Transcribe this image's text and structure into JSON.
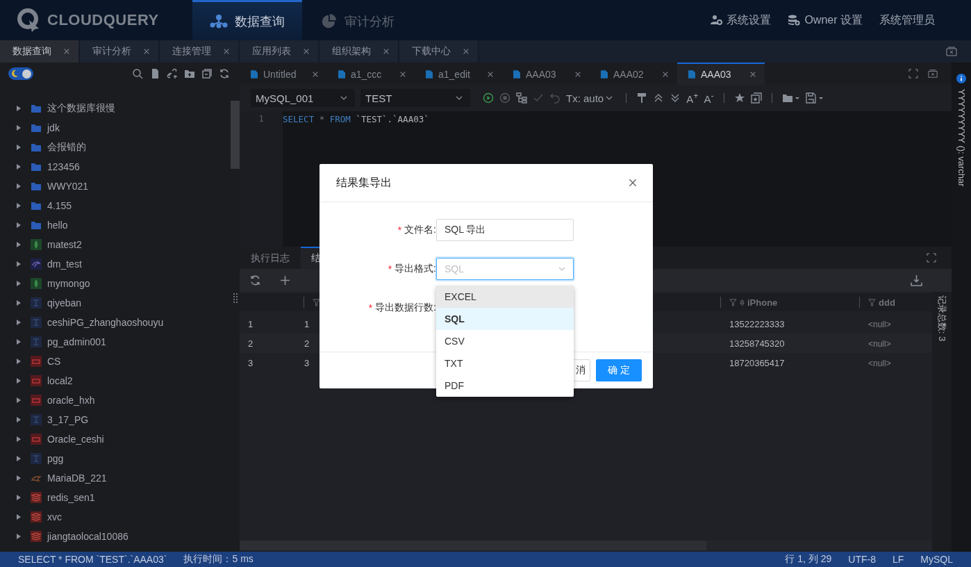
{
  "top_bar": {
    "logo": "CLOUDQUERY",
    "nav": [
      {
        "label": "数据查询",
        "selected": true
      },
      {
        "label": "审计分析",
        "selected": false
      }
    ],
    "actions": [
      "系统设置",
      "Owner 设置",
      "系统管理员"
    ]
  },
  "app_tabs": [
    {
      "label": "数据查询",
      "selected": true
    },
    {
      "label": "审计分析",
      "selected": false
    },
    {
      "label": "连接管理",
      "selected": false
    },
    {
      "label": "应用列表",
      "selected": false
    },
    {
      "label": "组织架构",
      "selected": false
    },
    {
      "label": "下载中心",
      "selected": false
    }
  ],
  "sidebar": {
    "dark_mode": true,
    "tree": [
      {
        "label": "这个数据库很慢",
        "kind": "folder"
      },
      {
        "label": "jdk",
        "kind": "folder"
      },
      {
        "label": "会报错的",
        "kind": "folder"
      },
      {
        "label": "123456",
        "kind": "folder"
      },
      {
        "label": "WWY021",
        "kind": "folder"
      },
      {
        "label": "4.155",
        "kind": "folder"
      },
      {
        "label": "hello",
        "kind": "folder"
      },
      {
        "label": "matest2",
        "kind": "mongo"
      },
      {
        "label": "dm_test",
        "kind": "dm"
      },
      {
        "label": "mymongo",
        "kind": "mongo"
      },
      {
        "label": "qiyeban",
        "kind": "pg"
      },
      {
        "label": "ceshiPG_zhanghaoshouyu",
        "kind": "pg"
      },
      {
        "label": "pg_admin001",
        "kind": "pg"
      },
      {
        "label": "CS",
        "kind": "oracle"
      },
      {
        "label": "local2",
        "kind": "oracle"
      },
      {
        "label": "oracle_hxh",
        "kind": "oracle"
      },
      {
        "label": "3_17_PG",
        "kind": "pg"
      },
      {
        "label": "Oracle_ceshi",
        "kind": "oracle"
      },
      {
        "label": "pgg",
        "kind": "pg"
      },
      {
        "label": "MariaDB_221",
        "kind": "mariadb"
      },
      {
        "label": "redis_sen1",
        "kind": "redis"
      },
      {
        "label": "xvc",
        "kind": "redis"
      },
      {
        "label": "jiangtaolocal10086",
        "kind": "redis"
      }
    ]
  },
  "editor_tabs": [
    {
      "label": "Untitled",
      "selected": false
    },
    {
      "label": "a1_ccc",
      "selected": false
    },
    {
      "label": "a1_edit",
      "selected": false
    },
    {
      "label": "AAA03",
      "selected": false
    },
    {
      "label": "AAA02",
      "selected": false
    },
    {
      "label": "AAA03",
      "selected": true
    }
  ],
  "editor_toolbar": {
    "connection": "MySQL_001",
    "database": "TEST",
    "transaction": "Tx: auto",
    "font_buttons": [
      "A$^{+}$",
      "A$^{-}$"
    ]
  },
  "editor": {
    "lines": [
      {
        "number": "1",
        "tokens": [
          {
            "text": "SELECT",
            "kind": "keyword"
          },
          {
            "text": " * ",
            "kind": "operator"
          },
          {
            "text": "FROM",
            "kind": "keyword"
          },
          {
            "text": " `TEST`.`AAA03`",
            "kind": "identifier"
          }
        ]
      }
    ]
  },
  "result": {
    "tabs": [
      {
        "label": "执行日志",
        "selected": false
      },
      {
        "label": "结",
        "selected": true
      }
    ],
    "record_count": "记录总数: 3",
    "columns": [
      {
        "kind": "index"
      },
      {
        "kind": "filter"
      },
      {
        "kind": "sortable",
        "header": "iPhone"
      },
      {
        "kind": "filter",
        "header": "ddd"
      }
    ],
    "rows": [
      [
        "1",
        "1",
        "13522223333",
        "<null>"
      ],
      [
        "2",
        "2",
        "13258745320",
        "<null>"
      ],
      [
        "3",
        "3",
        "18720365417",
        "<null>"
      ]
    ]
  },
  "side_panel": {
    "column_info": "YYYYYYYYY (): varchar"
  },
  "dialog": {
    "title": "结果集导出",
    "fields": [
      {
        "mark": "*",
        "label": "文件名:",
        "kind": "input",
        "value": "SQL 导出"
      },
      {
        "mark": "*",
        "label": "导出格式:",
        "kind": "select",
        "placeholder": "SQL",
        "open": true,
        "options": [
          {
            "label": "EXCEL",
            "selected": false,
            "hovered": true
          },
          {
            "label": "SQL",
            "selected": true,
            "hovered": false
          },
          {
            "label": "CSV",
            "selected": false,
            "hovered": false
          },
          {
            "label": "TXT",
            "selected": false,
            "hovered": false
          },
          {
            "label": "PDF",
            "selected": false,
            "hovered": false
          }
        ]
      },
      {
        "mark": "*",
        "label": "导出数据行数:"
      }
    ],
    "buttons": [
      {
        "label": "消",
        "kind": "secondary"
      },
      {
        "label": "确 定",
        "kind": "primary"
      }
    ]
  },
  "status_bar": {
    "left": [
      "SELECT * FROM `TEST`.`AAA03`",
      "执行时间：5 ms"
    ],
    "right": [
      "行 1, 列 29",
      "UTF-8",
      "LF",
      "MySQL"
    ]
  }
}
